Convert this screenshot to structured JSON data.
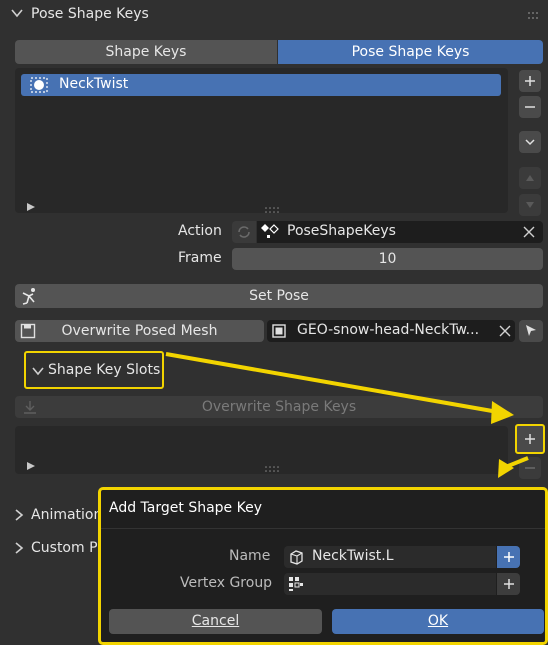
{
  "panel": {
    "title": "Pose Shape Keys",
    "tabs": [
      {
        "label": "Shape Keys",
        "active": false
      },
      {
        "label": "Pose Shape Keys",
        "active": true
      }
    ],
    "list_items": [
      {
        "label": "NeckTwist",
        "selected": true
      }
    ],
    "action_label": "Action",
    "action_value": "PoseShapeKeys",
    "frame_label": "Frame",
    "frame_value": "10",
    "set_pose_label": "Set Pose",
    "overwrite_posed_mesh_label": "Overwrite Posed Mesh",
    "mesh_field_value": "GEO-snow-head-NeckTw...",
    "shape_key_slots_label": "Shape Key Slots",
    "overwrite_shape_keys_label": "Overwrite Shape Keys",
    "collapsed_sections": [
      "Animation",
      "Custom Pr"
    ]
  },
  "dialog": {
    "title": "Add Target Shape Key",
    "name_label": "Name",
    "name_value": "NeckTwist.L",
    "vertex_group_label": "Vertex Group",
    "vertex_group_value": "",
    "cancel_label": "Cancel",
    "ok_label": "OK"
  },
  "colors": {
    "accent": "#4772b3",
    "highlight": "#f2d400",
    "background": "#303030"
  }
}
